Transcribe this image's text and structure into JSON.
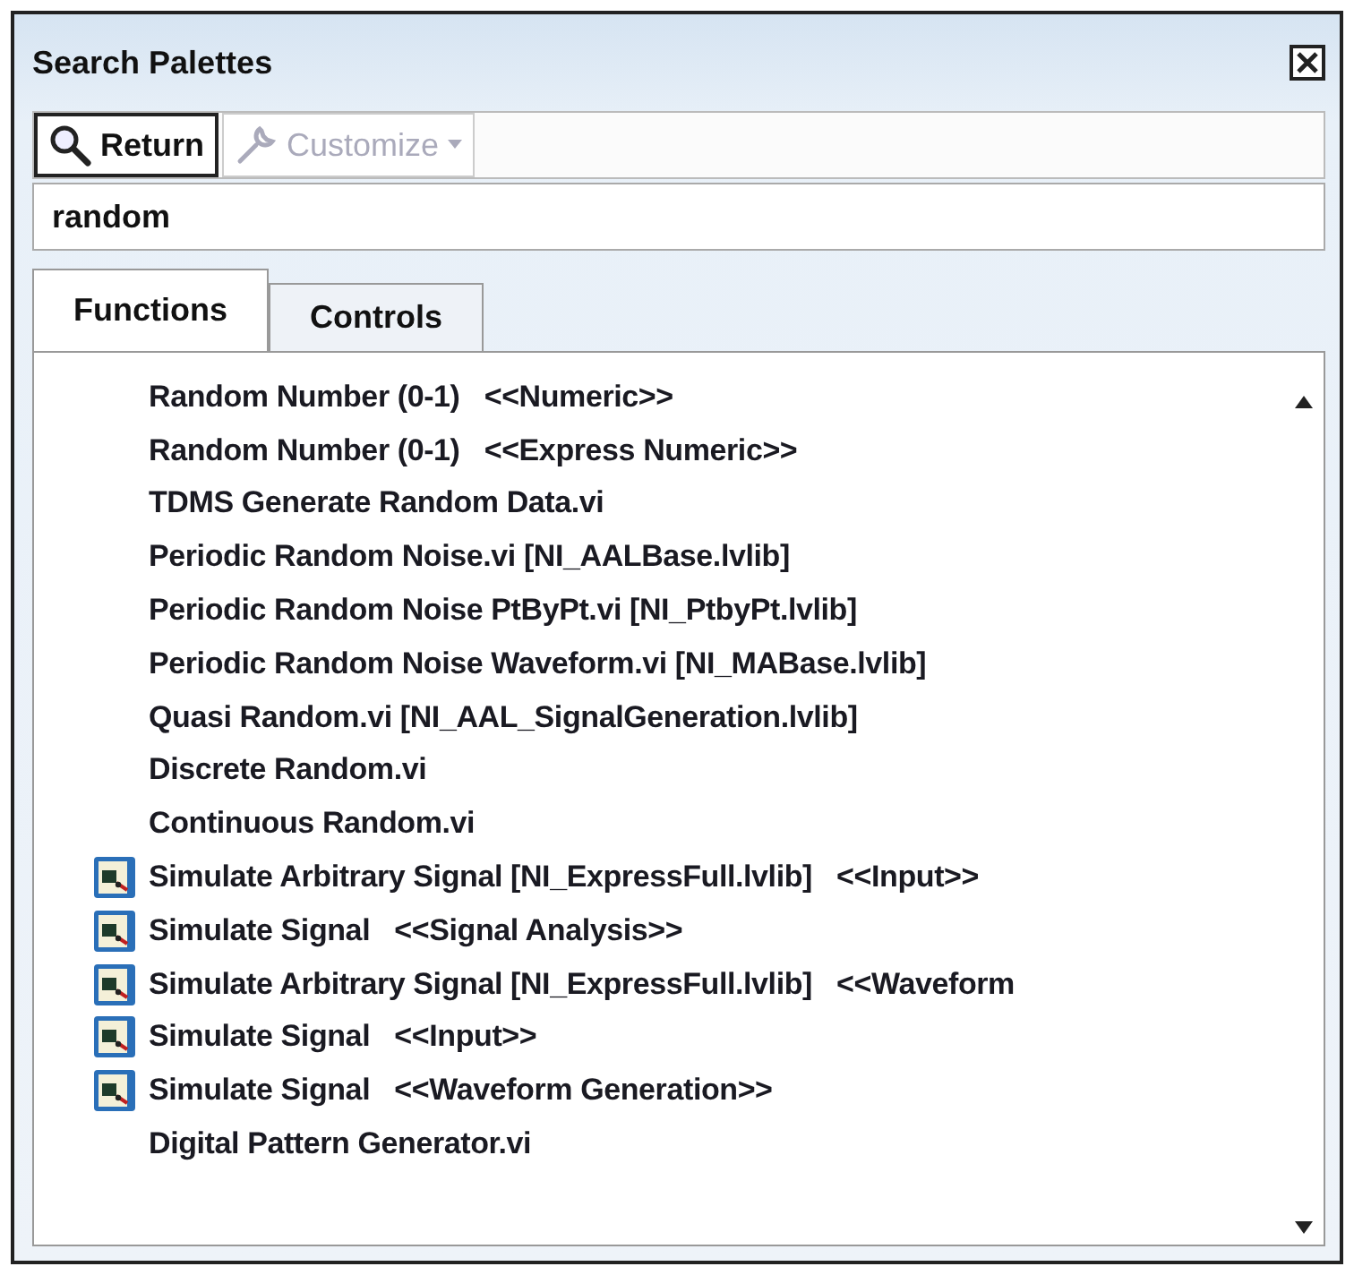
{
  "window": {
    "title": "Search Palettes"
  },
  "toolbar": [
    {
      "kind": "return",
      "label": "Return",
      "disabled": false
    },
    {
      "kind": "customize",
      "label": "Customize",
      "disabled": true
    }
  ],
  "search": {
    "value": "random"
  },
  "tabs": [
    {
      "label": "Functions",
      "selected": true
    },
    {
      "label": "Controls",
      "selected": false
    }
  ],
  "results": [
    {
      "kind": "plain",
      "label": "Random Number (0-1)   <<Numeric>>"
    },
    {
      "kind": "plain",
      "label": "Random Number (0-1)   <<Express Numeric>>"
    },
    {
      "kind": "plain",
      "label": "TDMS Generate Random Data.vi"
    },
    {
      "kind": "plain",
      "label": "Periodic Random Noise.vi [NI_AALBase.lvlib]"
    },
    {
      "kind": "plain",
      "label": "Periodic Random Noise PtByPt.vi [NI_PtbyPt.lvlib]"
    },
    {
      "kind": "plain",
      "label": "Periodic Random Noise Waveform.vi [NI_MABase.lvlib]"
    },
    {
      "kind": "plain",
      "label": "Quasi Random.vi [NI_AAL_SignalGeneration.lvlib]"
    },
    {
      "kind": "plain",
      "label": "Discrete Random.vi"
    },
    {
      "kind": "plain",
      "label": "Continuous Random.vi"
    },
    {
      "kind": "express",
      "label": "Simulate Arbitrary Signal [NI_ExpressFull.lvlib]   <<Input>>"
    },
    {
      "kind": "express",
      "label": "Simulate Signal   <<Signal Analysis>>"
    },
    {
      "kind": "express",
      "label": "Simulate Arbitrary Signal [NI_ExpressFull.lvlib]   <<Waveform"
    },
    {
      "kind": "express",
      "label": "Simulate Signal   <<Input>>"
    },
    {
      "kind": "express",
      "label": "Simulate Signal   <<Waveform Generation>>"
    },
    {
      "kind": "plain",
      "label": "Digital Pattern Generator.vi"
    }
  ]
}
